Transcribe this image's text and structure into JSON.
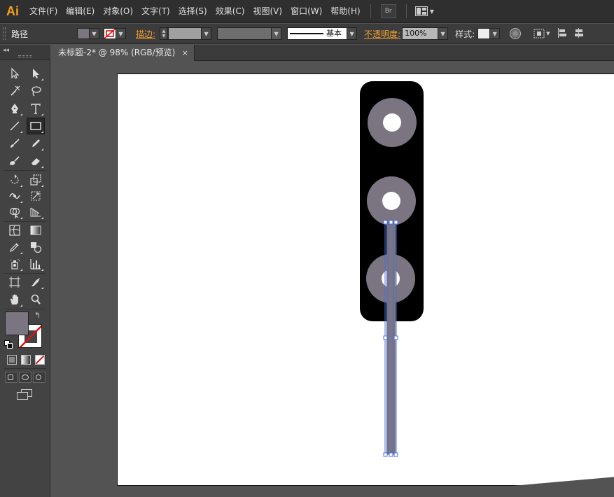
{
  "app": {
    "logo": "Ai"
  },
  "menubar": {
    "items": [
      "文件(F)",
      "编辑(E)",
      "对象(O)",
      "文字(T)",
      "选择(S)",
      "效果(C)",
      "视图(V)",
      "窗口(W)",
      "帮助(H)"
    ],
    "bridge_label": "Br",
    "workspace_icon": "workspace-layout-icon"
  },
  "controlbar": {
    "selection_type": "路径",
    "stroke_label": "描边:",
    "brush_label": "基本",
    "opacity_label": "不透明度:",
    "opacity_value": "100%",
    "style_label": "样式:",
    "fill_color": "#7a7580",
    "stroke_none": true
  },
  "document": {
    "tab_title": "未标题-2* @ 98% (RGB/预览)",
    "close_label": "×"
  },
  "toolbar": {
    "fill_color": "#7a7580",
    "tools": [
      "selection-tool",
      "direct-selection-tool",
      "magic-wand-tool",
      "lasso-tool",
      "pen-tool",
      "type-tool",
      "line-segment-tool",
      "rectangle-tool",
      "paintbrush-tool",
      "pencil-tool",
      "blob-brush-tool",
      "eraser-tool",
      "rotate-tool",
      "scale-tool",
      "warp-tool",
      "free-transform-tool",
      "shape-builder-tool",
      "perspective-grid-tool",
      "mesh-tool",
      "gradient-tool",
      "eyedropper-tool",
      "blend-tool",
      "symbol-sprayer-tool",
      "column-graph-tool",
      "artboard-tool",
      "slice-tool",
      "hand-tool",
      "zoom-tool"
    ],
    "active_tool": "rectangle-tool"
  },
  "artwork": {
    "body_color": "#000000",
    "ring_color": "#7a7580",
    "hole_color": "#ffffff",
    "pole_color": "#7a7580",
    "selection_color": "#4a6fd8"
  }
}
